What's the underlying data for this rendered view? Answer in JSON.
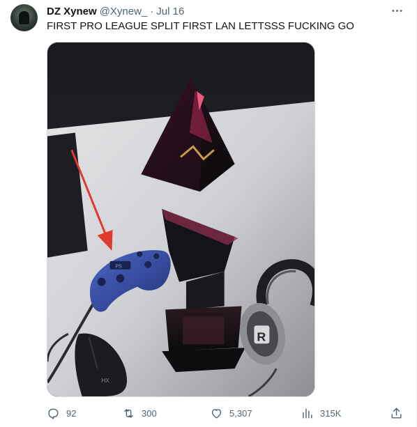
{
  "tweet": {
    "author_name": "DZ Xynew",
    "handle": "@Xynew_",
    "separator": "·",
    "date": "Jul 16",
    "text": "FIRST PRO LEAGUE SPLIT FIRST LAN LETTSSS FUCKING GO",
    "media": {
      "controller_logo": "PS",
      "headset_letter": "R",
      "mouse_logo": "HX"
    }
  },
  "actions": {
    "replies": "92",
    "retweets": "300",
    "likes": "5,307",
    "views": "315K"
  },
  "icons": {
    "more": "more-icon",
    "reply": "reply-icon",
    "retweet": "retweet-icon",
    "like": "heart-icon",
    "views": "views-icon",
    "share": "share-icon"
  },
  "colors": {
    "text_primary": "#0f1419",
    "text_secondary": "#536471",
    "border": "#cfd9de",
    "arrow_red": "#e03a2f",
    "controller_blue": "#3a52a3"
  }
}
